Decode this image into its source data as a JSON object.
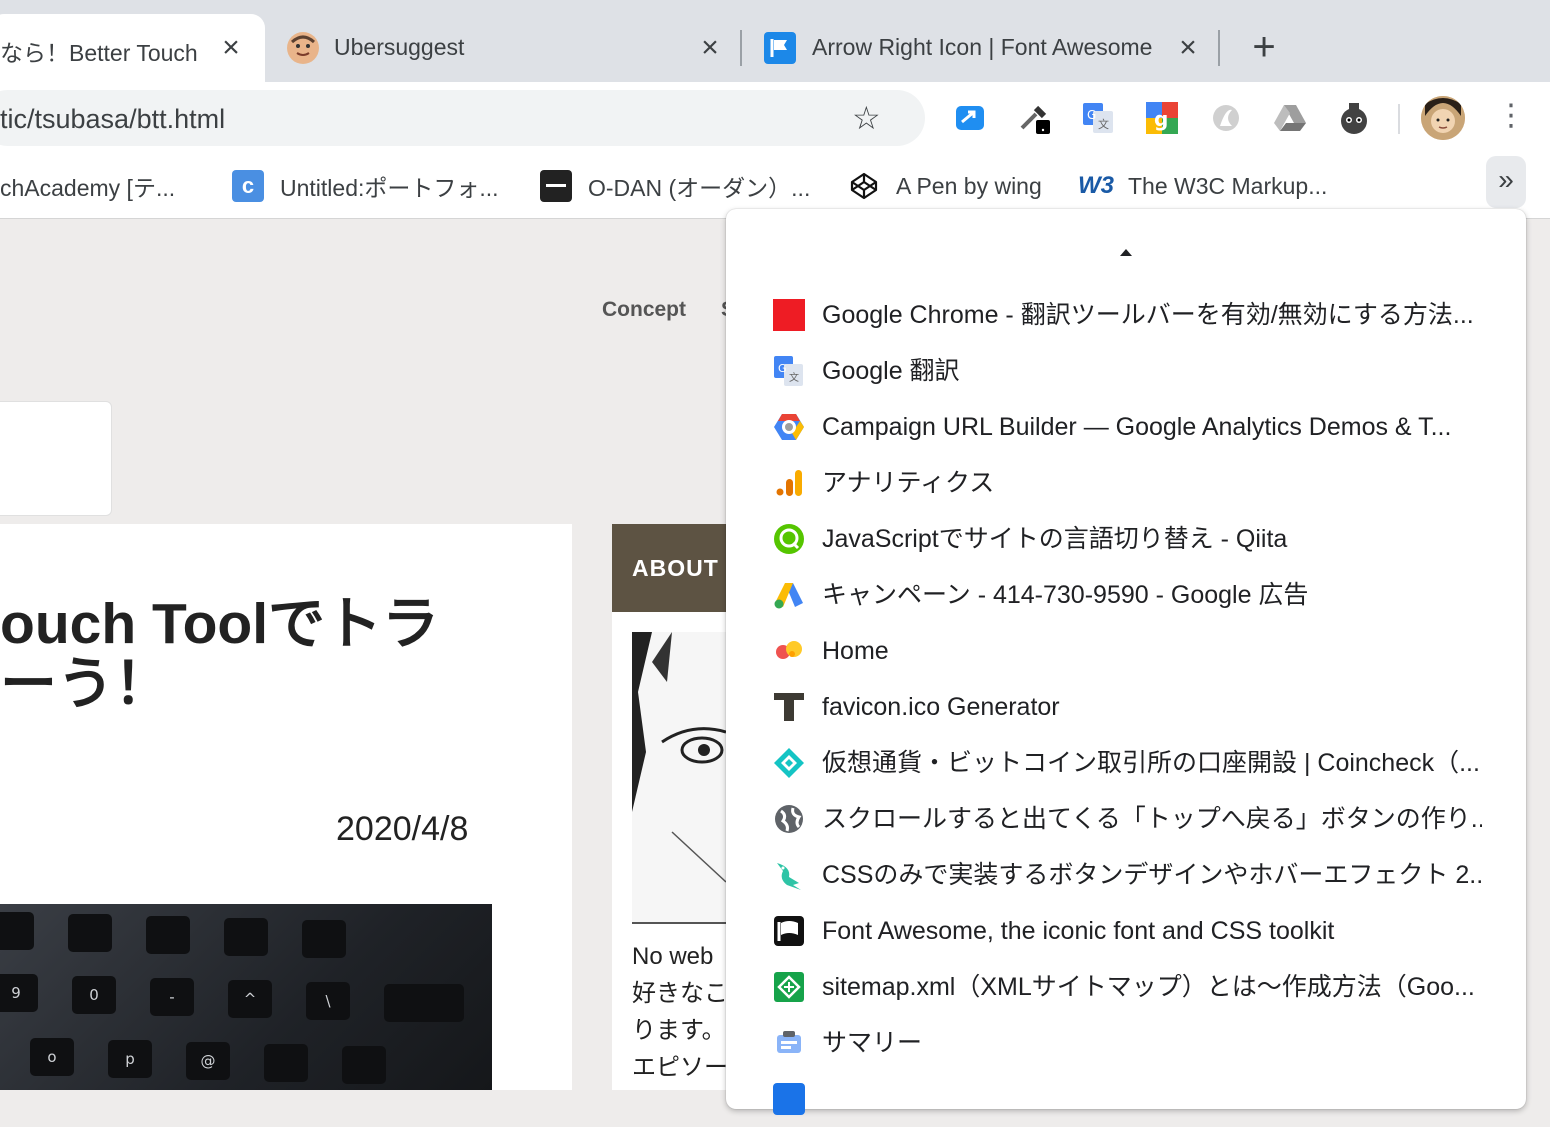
{
  "tabs": [
    {
      "title": "なら！Better Touch Tool",
      "active": true
    },
    {
      "title": "Ubersuggest",
      "active": false
    },
    {
      "title": "Arrow Right Icon | Font Awesome",
      "active": false
    }
  ],
  "omnibox": {
    "url": "tic/tsubasa/btt.html"
  },
  "bookmarks": [
    {
      "label": "chAcademy [テ..."
    },
    {
      "label": "Untitled:ポートフォ..."
    },
    {
      "label": "O-DAN (オーダン）..."
    },
    {
      "label": "A Pen by wing"
    },
    {
      "label": "The W3C Markup..."
    }
  ],
  "overflow_chevron": "»",
  "page": {
    "nav_concept": "Concept",
    "nav_partial": "S",
    "article_title": "ouch Toolでトラ\nーう！",
    "article_date": "2020/4/8",
    "about_heading": "ABOUT",
    "about_text": [
      "No web",
      "好きなこ",
      "ります。",
      "エピソー"
    ]
  },
  "keyboard_keys": [
    "9",
    "0",
    "-",
    "^",
    "\\",
    "",
    "o",
    "p",
    "@"
  ],
  "dropdown_items": [
    {
      "label": "Google Chrome - 翻訳ツールバーを有効/無効にする方法...",
      "icon": "red-square-icon"
    },
    {
      "label": "Google 翻訳",
      "icon": "google-translate-icon"
    },
    {
      "label": "Campaign URL Builder — Google Analytics Demos & T...",
      "icon": "google-cloud-icon"
    },
    {
      "label": "アナリティクス",
      "icon": "analytics-icon"
    },
    {
      "label": "JavaScriptでサイトの言語切り替え - Qiita",
      "icon": "qiita-icon"
    },
    {
      "label": "キャンペーン - 414-730-9590 - Google 広告",
      "icon": "google-ads-icon"
    },
    {
      "label": "Home",
      "icon": "home-blob-icon"
    },
    {
      "label": "favicon.ico Generator",
      "icon": "letter-t-icon"
    },
    {
      "label": "仮想通貨・ビットコイン取引所の口座開設 | Coincheck（...",
      "icon": "coincheck-icon"
    },
    {
      "label": "スクロールすると出てくる「トップへ戻る」ボタンの作り...",
      "icon": "globe-icon"
    },
    {
      "label": "CSSのみで実装するボタンデザインやホバーエフェクト 2...",
      "icon": "bird-icon"
    },
    {
      "label": "Font Awesome, the iconic font and CSS toolkit",
      "icon": "font-awesome-flag-icon"
    },
    {
      "label": "sitemap.xml（XMLサイトマップ）とは〜作成方法（Goo...",
      "icon": "sitemap-icon"
    },
    {
      "label": "サマリー",
      "icon": "summary-icon"
    }
  ],
  "colors": {
    "tabstrip": "#dee1e6",
    "page_bg": "#eeeceb",
    "about_header": "#5d5343",
    "font_awesome_blue": "#1c88e8"
  }
}
